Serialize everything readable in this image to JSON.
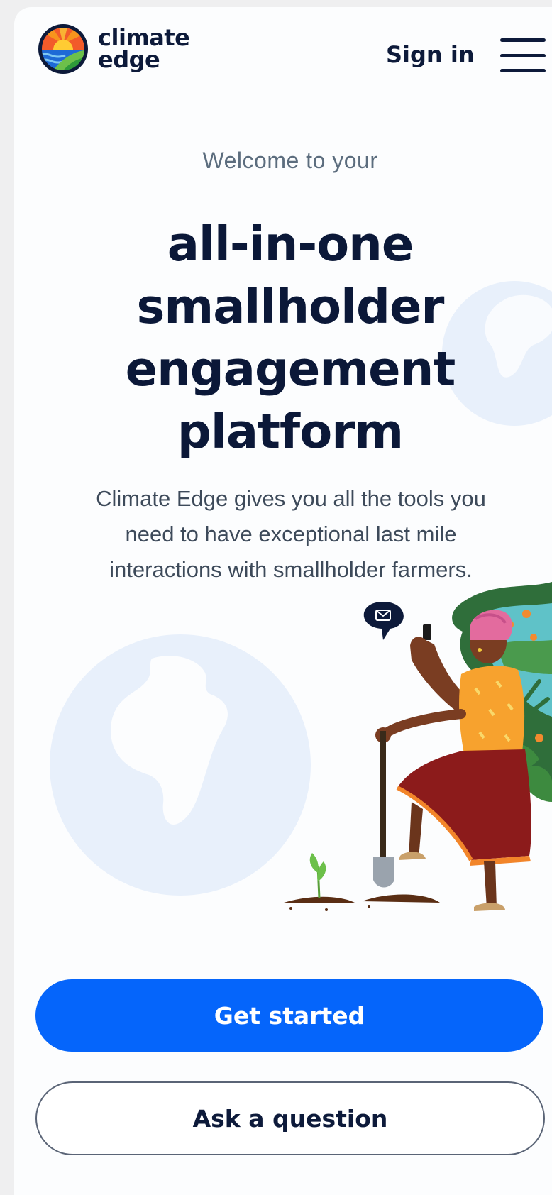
{
  "header": {
    "logo_line1": "climate",
    "logo_line2": "edge",
    "sign_in_label": "Sign in",
    "menu_icon": "hamburger-menu-icon"
  },
  "hero": {
    "welcome": "Welcome to your",
    "headline_lines": [
      "all-in-one",
      "smallholder",
      "engagement",
      "platform"
    ],
    "description_lines": [
      "Climate Edge gives you all the tools you",
      "need to have exceptional last mile",
      "interactions with smallholder farmers."
    ]
  },
  "actions": {
    "primary_label": "Get started",
    "secondary_label": "Ask a question"
  },
  "colors": {
    "brand_navy": "#0b1838",
    "primary_blue": "#0565fb",
    "globe_tint": "#e8f0fb"
  }
}
